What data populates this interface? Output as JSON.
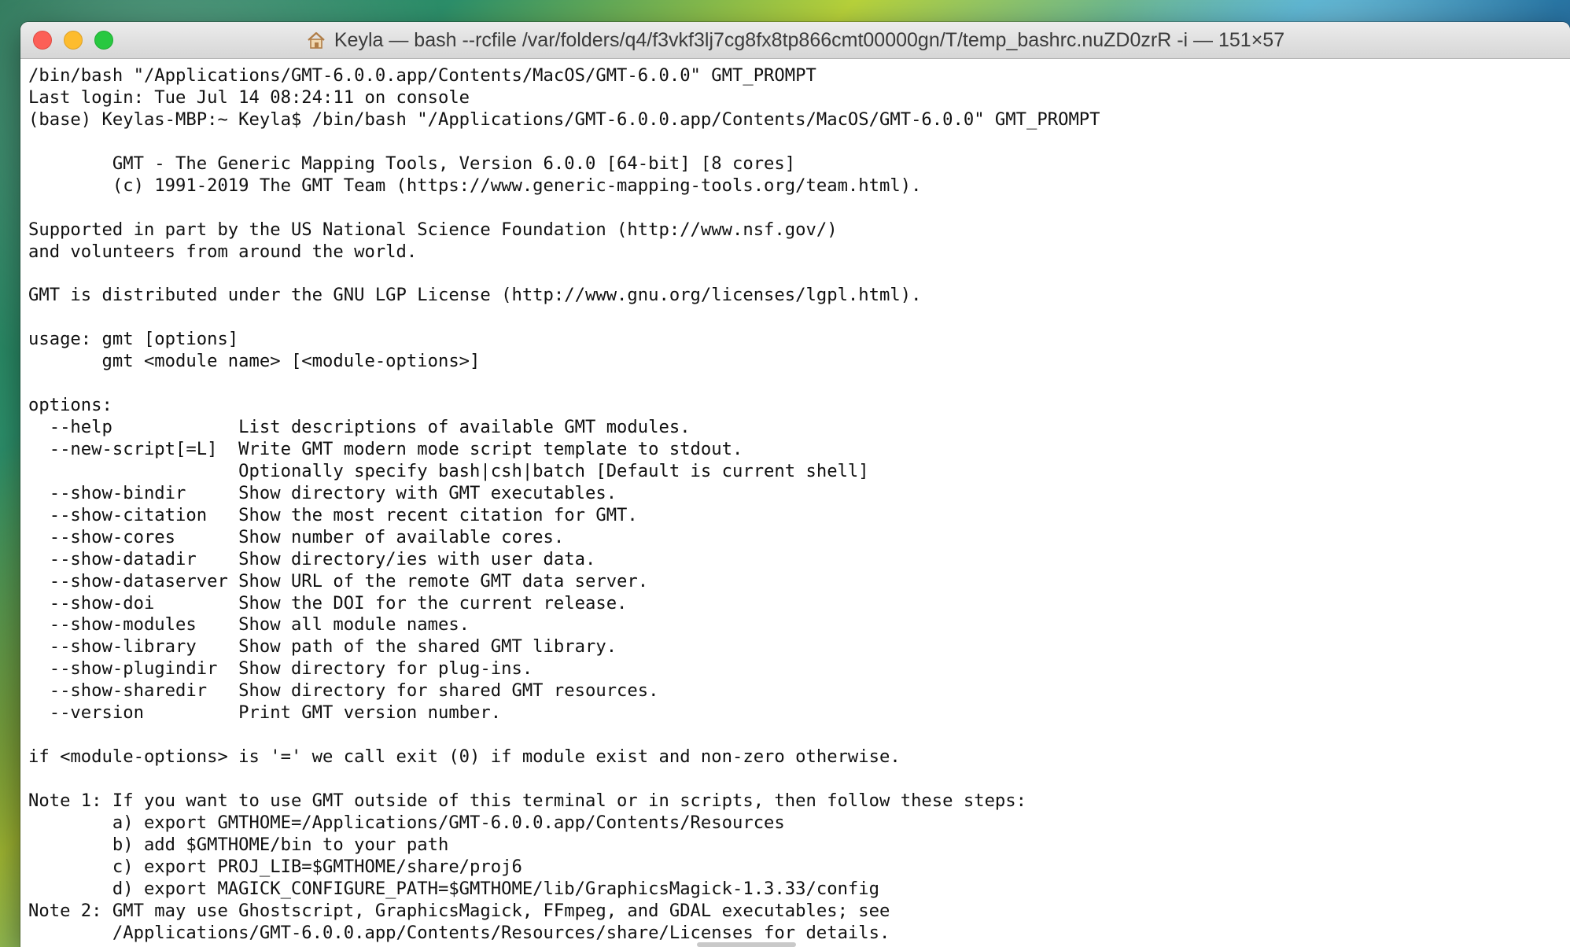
{
  "window": {
    "title": "Keyla — bash --rcfile /var/folders/q4/f3vkf3lj7cg8fx8tp866cmt00000gn/T/temp_bashrc.nuZD0zrR -i — 151×57",
    "title_icon": "home-icon",
    "buttons": {
      "close": "close-button",
      "minimize": "minimize-button",
      "zoom": "zoom-button"
    },
    "colors": {
      "close": "#fc5f57",
      "minimize": "#fdbc2e",
      "zoom": "#28c840"
    }
  },
  "terminal": {
    "lines": [
      "/bin/bash \"/Applications/GMT-6.0.0.app/Contents/MacOS/GMT-6.0.0\" GMT_PROMPT",
      "Last login: Tue Jul 14 08:24:11 on console",
      "(base) Keylas-MBP:~ Keyla$ /bin/bash \"/Applications/GMT-6.0.0.app/Contents/MacOS/GMT-6.0.0\" GMT_PROMPT",
      "",
      "        GMT - The Generic Mapping Tools, Version 6.0.0 [64-bit] [8 cores]",
      "        (c) 1991-2019 The GMT Team (https://www.generic-mapping-tools.org/team.html).",
      "",
      "Supported in part by the US National Science Foundation (http://www.nsf.gov/)",
      "and volunteers from around the world.",
      "",
      "GMT is distributed under the GNU LGP License (http://www.gnu.org/licenses/lgpl.html).",
      "",
      "usage: gmt [options]",
      "       gmt <module name> [<module-options>]",
      "",
      "options:",
      "  --help            List descriptions of available GMT modules.",
      "  --new-script[=L]  Write GMT modern mode script template to stdout.",
      "                    Optionally specify bash|csh|batch [Default is current shell]",
      "  --show-bindir     Show directory with GMT executables.",
      "  --show-citation   Show the most recent citation for GMT.",
      "  --show-cores      Show number of available cores.",
      "  --show-datadir    Show directory/ies with user data.",
      "  --show-dataserver Show URL of the remote GMT data server.",
      "  --show-doi        Show the DOI for the current release.",
      "  --show-modules    Show all module names.",
      "  --show-library    Show path of the shared GMT library.",
      "  --show-plugindir  Show directory for plug-ins.",
      "  --show-sharedir   Show directory for shared GMT resources.",
      "  --version         Print GMT version number.",
      "",
      "if <module-options> is '=' we call exit (0) if module exist and non-zero otherwise.",
      "",
      "Note 1: If you want to use GMT outside of this terminal or in scripts, then follow these steps:",
      "        a) export GMTHOME=/Applications/GMT-6.0.0.app/Contents/Resources",
      "        b) add $GMTHOME/bin to your path",
      "        c) export PROJ_LIB=$GMTHOME/share/proj6",
      "        d) export MAGICK_CONFIGURE_PATH=$GMTHOME/lib/GraphicsMagick-1.3.33/config",
      "Note 2: GMT may use Ghostscript, GraphicsMagick, FFmpeg, and GDAL executables; see",
      "        /Applications/GMT-6.0.0.app/Contents/Resources/share/Licenses for details."
    ]
  }
}
